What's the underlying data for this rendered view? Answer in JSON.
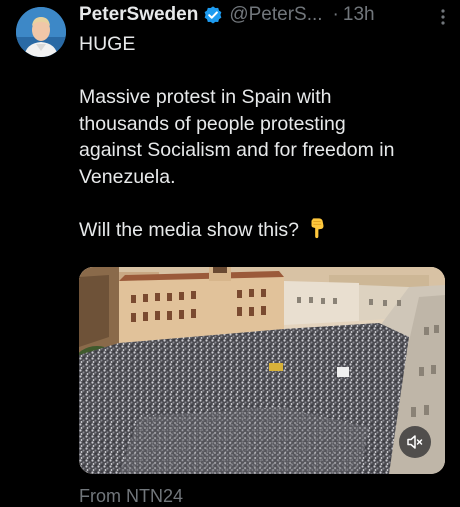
{
  "tweet": {
    "author": {
      "display_name": "PeterSweden",
      "handle": "@PeterS...",
      "verified": true,
      "avatar_icon": "profile-photo"
    },
    "separator": "·",
    "time": "13h",
    "more_icon": "more-vertical-icon",
    "text_lines": {
      "line1": "HUGE",
      "line2": "Massive protest in Spain with",
      "line3": "thousands of people protesting",
      "line4": "against Socialism and for freedom in",
      "line5": "Venezuela.",
      "line6": "Will the media show this?"
    },
    "emoji": "pointing-down-hand-emoji",
    "media": {
      "type": "video",
      "mute_icon": "volume-muted-icon"
    },
    "source": "From NTN24"
  },
  "colors": {
    "background": "#000000",
    "text": "#e7e9ea",
    "secondary": "#71767b",
    "verified": "#1d9bf0"
  }
}
